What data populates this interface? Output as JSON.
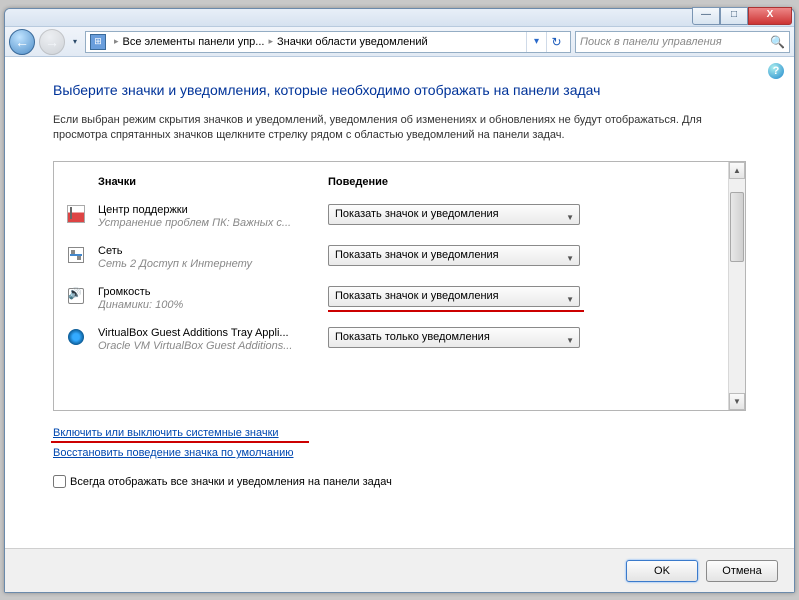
{
  "titlebar": {
    "min": "—",
    "max": "□",
    "close": "X"
  },
  "nav": {
    "back": "←",
    "fwd": "→",
    "drop": "▾"
  },
  "breadcrumb": {
    "item1": "Все элементы панели упр...",
    "item2": "Значки области уведомлений",
    "sep": "▸",
    "drop": "▾",
    "refresh": "↻"
  },
  "search": {
    "placeholder": "Поиск в панели управления",
    "icon": "🔍"
  },
  "help": "?",
  "heading": "Выберите значки и уведомления, которые необходимо отображать на панели задач",
  "description": "Если выбран режим скрытия значков и уведомлений, уведомления об изменениях и обновлениях не будут отображаться. Для просмотра спрятанных значков щелкните стрелку рядом с областью уведомлений на панели задач.",
  "columns": {
    "c1": "Значки",
    "c2": "Поведение"
  },
  "rows": [
    {
      "name": "Центр поддержки",
      "desc": "Устранение проблем ПК: Важных с...",
      "behavior": "Показать значок и уведомления",
      "highlight": false
    },
    {
      "name": "Сеть",
      "desc": "Сеть 2 Доступ к Интернету",
      "behavior": "Показать значок и уведомления",
      "highlight": false
    },
    {
      "name": "Громкость",
      "desc": "Динамики: 100%",
      "behavior": "Показать значок и уведомления",
      "highlight": true
    },
    {
      "name": "VirtualBox Guest Additions Tray Appli...",
      "desc": "Oracle VM VirtualBox Guest Additions...",
      "behavior": "Показать только уведомления",
      "highlight": false
    }
  ],
  "link1": "Включить или выключить системные значки",
  "link2": "Восстановить поведение значка по умолчанию",
  "checkbox_label": "Всегда отображать все значки и уведомления на панели задач",
  "buttons": {
    "ok": "OK",
    "cancel": "Отмена"
  },
  "scrollbar": {
    "up": "▲",
    "down": "▼"
  }
}
